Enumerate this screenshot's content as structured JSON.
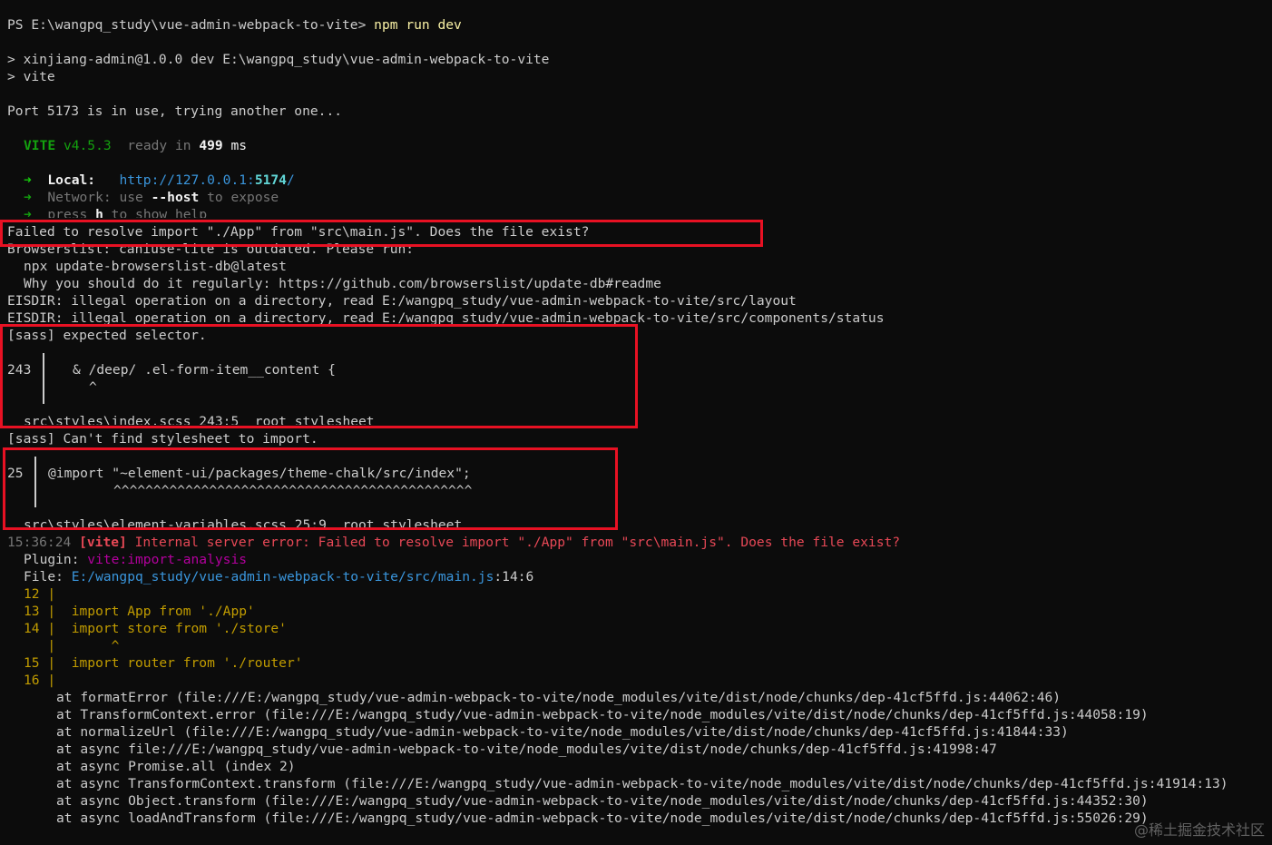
{
  "terminal": {
    "prompt": "PS E:\\wangpq_study\\vue-admin-webpack-to-vite> ",
    "command": "npm run dev",
    "script_line1": "> xinjiang-admin@1.0.0 dev E:\\wangpq_study\\vue-admin-webpack-to-vite",
    "script_line2": "> vite",
    "port_msg": "Port 5173 is in use, trying another one...",
    "vite": {
      "name": "VITE",
      "version": "v4.5.3",
      "ready": "ready in",
      "ms_value": "499",
      "ms_unit": " ms"
    },
    "local": {
      "arrow": "➜",
      "label": "Local:",
      "url_prefix": "http://127.0.0.1:",
      "port": "5174",
      "url_suffix": "/"
    },
    "network": {
      "arrow": "➜",
      "label": "Network:",
      "use": " use ",
      "flag": "--host",
      "rest": " to expose"
    },
    "help": {
      "arrow": "➜",
      "press": "press ",
      "key": "h",
      "rest": " to show help"
    },
    "err_resolve": "Failed to resolve import \"./App\" from \"src\\main.js\". Does the file exist?",
    "browserslist1": "Browserslist: caniuse-lite is outdated. Please run:",
    "browserslist2": "npx update-browserslist-db@latest",
    "browserslist3": "Why you should do it regularly: https://github.com/browserslist/update-db#readme",
    "eisdir1": "EISDIR: illegal operation on a directory, read E:/wangpq_study/vue-admin-webpack-to-vite/src/layout",
    "eisdir2": "EISDIR: illegal operation on a directory, read E:/wangpq_study/vue-admin-webpack-to-vite/src/components/status",
    "sass1": {
      "head": "[sass] expected selector.",
      "line_no": "243",
      "code": "& /deep/ .el-form-item__content {",
      "caret": "^",
      "loc": "src\\styles\\index.scss 243:5  root stylesheet"
    },
    "sass2": {
      "head": "[sass] Can't find stylesheet to import.",
      "line_no": "25",
      "code": "@import \"~element-ui/packages/theme-chalk/src/index\";",
      "caret": "^^^^^^^^^^^^^^^^^^^^^^^^^^^^^^^^^^^^^^^^^^^^^",
      "loc": "src\\styles\\element-variables.scss 25:9  root stylesheet"
    },
    "vite_err": {
      "time": "15:36:24",
      "tag": " [vite]",
      "message": " Internal server error: Failed to resolve import \"./App\" from \"src\\main.js\". Does the file exist?"
    },
    "plugin": {
      "label": "Plugin: ",
      "value": "vite:import-analysis"
    },
    "file": {
      "label": "File: ",
      "path": "E:/wangpq_study/vue-admin-webpack-to-vite/src/main.js",
      "pos": ":14:6"
    },
    "code_frame": [
      {
        "no": "12",
        "sep": " |",
        "code": ""
      },
      {
        "no": "13",
        "sep": " |",
        "code": "  import App from './App'"
      },
      {
        "no": "14",
        "sep": " |",
        "code": "  import store from './store'"
      },
      {
        "no": "  ",
        "sep": " |",
        "code": "       ^"
      },
      {
        "no": "15",
        "sep": " |",
        "code": "  import router from './router'"
      },
      {
        "no": "16",
        "sep": " |",
        "code": ""
      }
    ],
    "stack": [
      "at formatError (file:///E:/wangpq_study/vue-admin-webpack-to-vite/node_modules/vite/dist/node/chunks/dep-41cf5ffd.js:44062:46)",
      "at TransformContext.error (file:///E:/wangpq_study/vue-admin-webpack-to-vite/node_modules/vite/dist/node/chunks/dep-41cf5ffd.js:44058:19)",
      "at normalizeUrl (file:///E:/wangpq_study/vue-admin-webpack-to-vite/node_modules/vite/dist/node/chunks/dep-41cf5ffd.js:41844:33)",
      "at async file:///E:/wangpq_study/vue-admin-webpack-to-vite/node_modules/vite/dist/node/chunks/dep-41cf5ffd.js:41998:47",
      "at async Promise.all (index 2)",
      "at async TransformContext.transform (file:///E:/wangpq_study/vue-admin-webpack-to-vite/node_modules/vite/dist/node/chunks/dep-41cf5ffd.js:41914:13)",
      "at async Object.transform (file:///E:/wangpq_study/vue-admin-webpack-to-vite/node_modules/vite/dist/node/chunks/dep-41cf5ffd.js:44352:30)",
      "at async loadAndTransform (file:///E:/wangpq_study/vue-admin-webpack-to-vite/node_modules/vite/dist/node/chunks/dep-41cf5ffd.js:55026:29)"
    ],
    "watermark": "@稀土掘金技术社区"
  },
  "colors": {
    "background": "#0c0c0c",
    "text": "#cccccc",
    "highlight_box": "#e81123",
    "error_text": "#e74856",
    "plugin_name": "#b4009e",
    "link": "#3a96dd",
    "code_frame": "#c19c00"
  }
}
